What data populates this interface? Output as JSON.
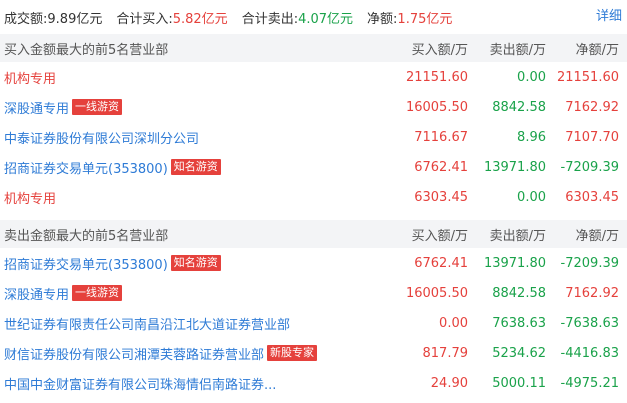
{
  "summary": {
    "turnover_label": "成交额:",
    "turnover_value": "9.89亿元",
    "total_buy_label": "合计买入:",
    "total_buy_value": "5.82亿元",
    "total_sell_label": "合计卖出:",
    "total_sell_value": "4.07亿元",
    "net_label": "净额:",
    "net_value": "1.75亿元",
    "detail_link": "详细"
  },
  "buy_section": {
    "title": "买入金额最大的前5名营业部",
    "col_buy": "买入额/万",
    "col_sell": "卖出额/万",
    "col_net": "净额/万",
    "rows": [
      {
        "name": "机构专用",
        "name_color": "red",
        "tag": "",
        "buy": "21151.60",
        "sell": "0.00",
        "net": "21151.60",
        "net_color": "red"
      },
      {
        "name": "深股通专用",
        "name_color": "blue",
        "tag": "一线游资",
        "buy": "16005.50",
        "sell": "8842.58",
        "net": "7162.92",
        "net_color": "red"
      },
      {
        "name": "中泰证券股份有限公司深圳分公司",
        "name_color": "blue",
        "tag": "",
        "buy": "7116.67",
        "sell": "8.96",
        "net": "7107.70",
        "net_color": "red"
      },
      {
        "name": "招商证券交易单元(353800)",
        "name_color": "blue",
        "tag": "知名游资",
        "buy": "6762.41",
        "sell": "13971.80",
        "net": "-7209.39",
        "net_color": "green"
      },
      {
        "name": "机构专用",
        "name_color": "red",
        "tag": "",
        "buy": "6303.45",
        "sell": "0.00",
        "net": "6303.45",
        "net_color": "red"
      }
    ]
  },
  "sell_section": {
    "title": "卖出金额最大的前5名营业部",
    "col_buy": "买入额/万",
    "col_sell": "卖出额/万",
    "col_net": "净额/万",
    "rows": [
      {
        "name": "招商证券交易单元(353800)",
        "name_color": "blue",
        "tag": "知名游资",
        "buy": "6762.41",
        "sell": "13971.80",
        "net": "-7209.39",
        "net_color": "green"
      },
      {
        "name": "深股通专用",
        "name_color": "blue",
        "tag": "一线游资",
        "buy": "16005.50",
        "sell": "8842.58",
        "net": "7162.92",
        "net_color": "red"
      },
      {
        "name": "世纪证券有限责任公司南昌沿江北大道证券营业部",
        "name_color": "blue",
        "tag": "",
        "buy": "0.00",
        "sell": "7638.63",
        "net": "-7638.63",
        "net_color": "green"
      },
      {
        "name": "财信证券股份有限公司湘潭芙蓉路证券营业部",
        "name_color": "blue",
        "tag": "新股专家",
        "buy": "817.79",
        "sell": "5234.62",
        "net": "-4416.83",
        "net_color": "green"
      },
      {
        "name": "中国中金财富证券有限公司珠海情侣南路证券...",
        "name_color": "blue",
        "tag": "",
        "buy": "24.90",
        "sell": "5000.11",
        "net": "-4975.21",
        "net_color": "green"
      }
    ]
  },
  "colors": {
    "red": "#e5413c",
    "green": "#1aa24a",
    "blue": "#2e7bd6",
    "header_bg": "#f3f4f6"
  }
}
